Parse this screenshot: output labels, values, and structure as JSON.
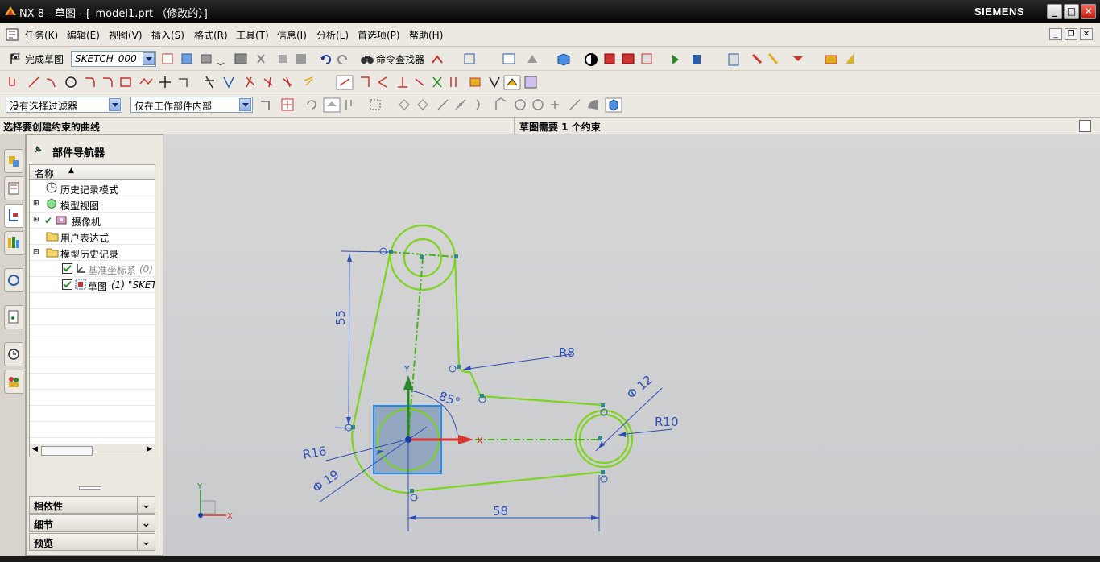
{
  "window": {
    "title": "NX 8 - 草图 - [_model1.prt （修改的）]",
    "brand": "SIEMENS",
    "controls": [
      "_",
      "□",
      "✕"
    ]
  },
  "menu": {
    "items": [
      "任务(K)",
      "编辑(E)",
      "视图(V)",
      "插入(S)",
      "格式(R)",
      "工具(T)",
      "信息(I)",
      "分析(L)",
      "首选项(P)",
      "帮助(H)"
    ]
  },
  "toolbar": {
    "finish_sketch": "完成草图",
    "sketch_name": "SKETCH_000",
    "command_finder": "命令查找器"
  },
  "selection_bar": {
    "filter": "没有选择过滤器",
    "scope": "仅在工作部件内部"
  },
  "status": {
    "prompt": "选择要创建约束的曲线",
    "message": "草图需要 1 个约束"
  },
  "navigator": {
    "title": "部件导航器",
    "column_header": "名称",
    "rows": [
      {
        "label": "历史记录模式",
        "extra": ""
      },
      {
        "label": "模型视图",
        "extra": ""
      },
      {
        "label": "摄像机",
        "extra": ""
      },
      {
        "label": "用户表达式",
        "extra": ""
      },
      {
        "label": "模型历史记录",
        "extra": ""
      },
      {
        "label": "基准坐标系",
        "extra": "(0)"
      },
      {
        "label": "草图",
        "extra": "(1) \"SKET"
      }
    ],
    "sections": [
      "相依性",
      "细节",
      "预览"
    ]
  },
  "sketch": {
    "dimensions": {
      "vertical": "55",
      "horizontal": "58",
      "angle": "85°",
      "r8": "R8",
      "r10": "R10",
      "r16": "R16",
      "d12": "Φ 12",
      "d19": "Φ 19"
    },
    "axis_labels": {
      "x": "X",
      "y": "Y"
    },
    "colors": {
      "curve": "#7ed321",
      "dimension": "#2d4fb4",
      "centerline": "#4caf1a"
    }
  }
}
